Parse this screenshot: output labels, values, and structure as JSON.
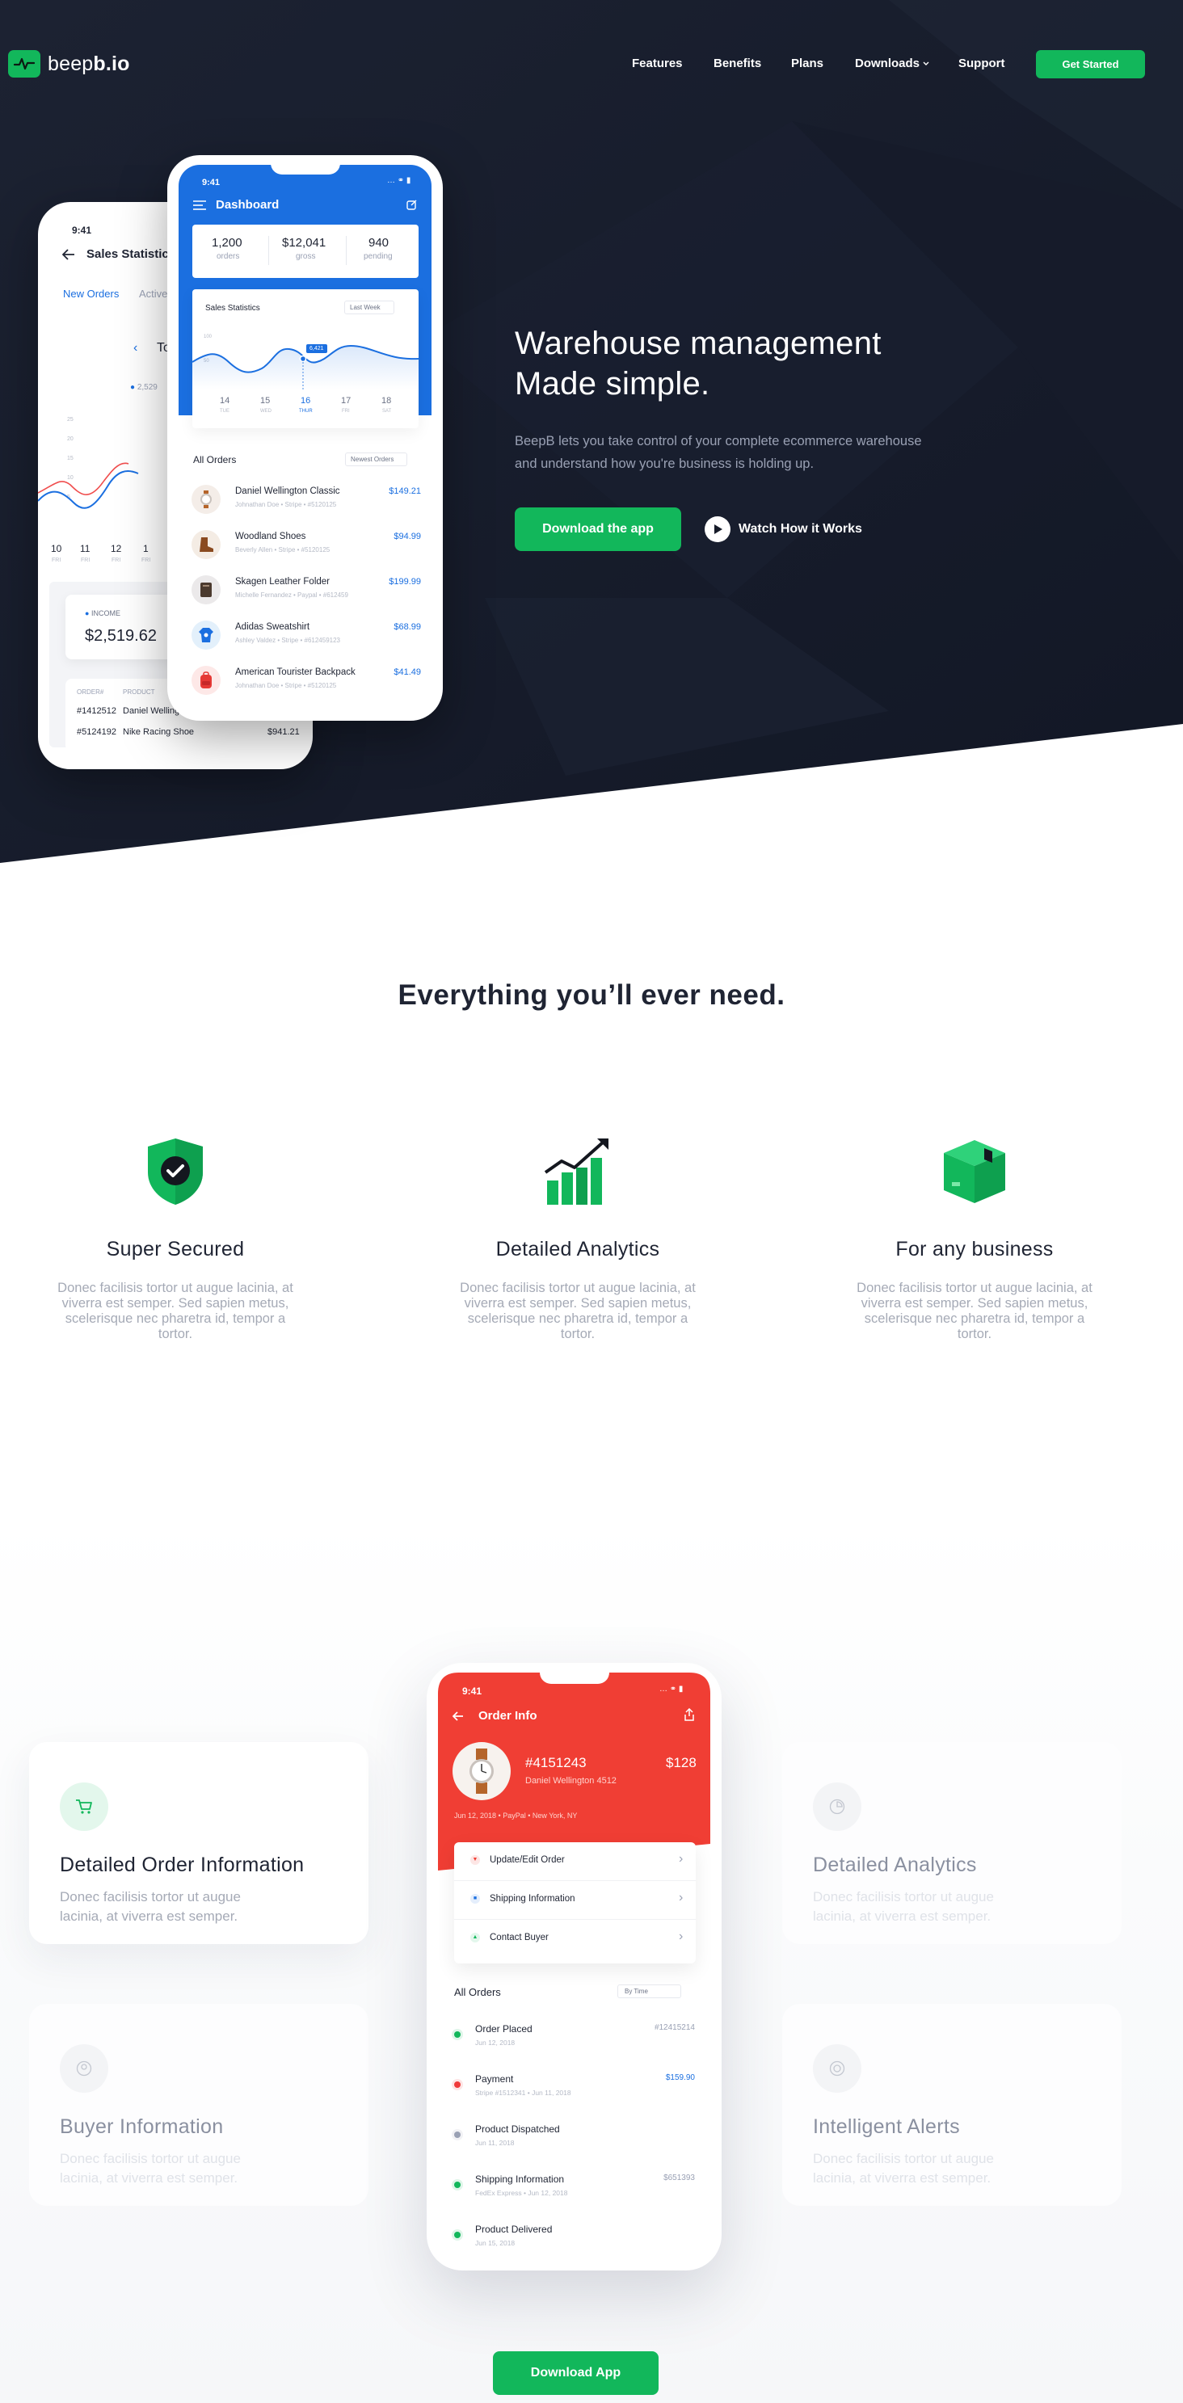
{
  "brand": {
    "name_light": "beep",
    "name_bold": "b.io",
    "accent": "#12b75b",
    "dark_bg": "#161b29"
  },
  "nav": {
    "links": [
      "Features",
      "Benefits",
      "Plans",
      "Downloads",
      "Support"
    ],
    "cta": "Get Started"
  },
  "hero": {
    "title_line1": "Warehouse management",
    "title_line2": "Made simple.",
    "description": "BeepB lets you take control of your complete ecommerce warehouse and understand how you're business is holding up.",
    "primary_button": "Download the app",
    "secondary_button": "Watch How it Works"
  },
  "phone_back": {
    "time": "9:41",
    "title": "Sales Statistics",
    "tabs": [
      "New Orders",
      "Active"
    ],
    "range_label": "To",
    "legend_value": "2,529",
    "y_ticks": [
      "25",
      "20",
      "15",
      "10",
      "5"
    ],
    "days": [
      {
        "num": "10",
        "abbr": "FRI"
      },
      {
        "num": "11",
        "abbr": "FRI"
      },
      {
        "num": "12",
        "abbr": "FRI"
      },
      {
        "num": "1",
        "abbr": "FRI"
      }
    ],
    "income_label": "INCOME",
    "income_value": "$2,519.62",
    "table_headers": [
      "ORDER#",
      "PRODUCT"
    ],
    "rows": [
      {
        "id": "#1412512",
        "product": "Daniel Wellington Wh...",
        "amount": "$149.50"
      },
      {
        "id": "#5124192",
        "product": "Nike Racing Shoe",
        "amount": "$941.21"
      }
    ]
  },
  "phone_front": {
    "time": "9:41",
    "title": "Dashboard",
    "stats": [
      {
        "value": "1,200",
        "label": "orders"
      },
      {
        "value": "$12,041",
        "label": "gross"
      },
      {
        "value": "940",
        "label": "pending"
      }
    ],
    "chart_title": "Sales Statistics",
    "chart_filter": "Last Week",
    "chart_tooltip": "6,421",
    "chart_y_ticks": [
      "100",
      "50"
    ],
    "days": [
      {
        "num": "14",
        "abbr": "TUE"
      },
      {
        "num": "15",
        "abbr": "WED"
      },
      {
        "num": "16",
        "abbr": "THUR"
      },
      {
        "num": "17",
        "abbr": "FRI"
      },
      {
        "num": "18",
        "abbr": "SAT"
      }
    ],
    "orders_title": "All Orders",
    "orders_filter": "Newest Orders",
    "orders": [
      {
        "name": "Daniel Wellington Classic",
        "meta": "Johnathan Doe  •  Stripe  •  #5120125",
        "price": "$149.21",
        "icon": "watch-icon"
      },
      {
        "name": "Woodland Shoes",
        "meta": "Beverly Allen  •  Stripe  •  #5120125",
        "price": "$94.99",
        "icon": "boot-icon"
      },
      {
        "name": "Skagen Leather Folder",
        "meta": "Michelle Fernandez  •  Paypal  •  #612459",
        "price": "$199.99",
        "icon": "folder-icon"
      },
      {
        "name": "Adidas Sweatshirt",
        "meta": "Ashley Valdez  •  Stripe  •  #612459123",
        "price": "$68.99",
        "icon": "sweatshirt-icon"
      },
      {
        "name": "American Tourister Backpack",
        "meta": "Johnathan Doe  •  Stripe  •  #5120125",
        "price": "$41.49",
        "icon": "backpack-icon"
      }
    ]
  },
  "features": {
    "heading": "Everything you’ll ever need.",
    "items": [
      {
        "title": "Super Secured",
        "text": "Donec facilisis tortor ut augue lacinia, at viverra est semper. Sed sapien metus, scelerisque nec pharetra id, tempor a tortor.",
        "icon": "shield-check-icon"
      },
      {
        "title": "Detailed Analytics",
        "text": "Donec facilisis tortor ut augue lacinia, at viverra est semper. Sed sapien metus, scelerisque nec pharetra id, tempor a tortor.",
        "icon": "growth-chart-icon"
      },
      {
        "title": "For any business",
        "text": "Donec facilisis tortor ut augue lacinia, at viverra est semper. Sed sapien metus, scelerisque nec pharetra id, tempor a tortor.",
        "icon": "box-icon"
      }
    ]
  },
  "details": {
    "cards": [
      {
        "title": "Detailed Order Information",
        "text": "Donec facilisis tortor ut augue lacinia, at viverra est semper.",
        "icon": "cart-icon"
      },
      {
        "title": "Buyer Information",
        "text": "Donec facilisis tortor ut augue lacinia, at viverra est semper.",
        "icon": "user-icon"
      },
      {
        "title": "Detailed Analytics",
        "text": "Donec facilisis tortor ut augue lacinia, at viverra est semper.",
        "icon": "pie-icon"
      },
      {
        "title": "Intelligent Alerts",
        "text": "Donec facilisis tortor ut augue lacinia, at viverra est semper.",
        "icon": "alert-icon"
      }
    ],
    "button": "Download App"
  },
  "phone_order": {
    "time": "9:41",
    "title": "Order Info",
    "order_id": "#4151243",
    "price": "$128",
    "product": "Daniel Wellington 4512",
    "meta": "Jun 12, 2018  •  PayPal  •  New York, NY",
    "actions": [
      "Update/Edit Order",
      "Shipping Information",
      "Contact Buyer"
    ],
    "list_title": "All Orders",
    "list_filter": "By Time",
    "events": [
      {
        "title": "Order Placed",
        "sub": "Jun 12, 2018",
        "value": "#12415214",
        "dot": "#12b75b"
      },
      {
        "title": "Payment",
        "sub": "Stripe #1512341  •  Jun 11, 2018",
        "value": "$159.90",
        "dot": "#f03a3a"
      },
      {
        "title": "Product Dispatched",
        "sub": "Jun 11, 2018",
        "value": "",
        "dot": "#9aa1b4"
      },
      {
        "title": "Shipping Information",
        "sub": "FedEx Express  •  Jun 12, 2018",
        "value": "$651393",
        "dot": "#12b75b"
      },
      {
        "title": "Product Delivered",
        "sub": "Jun 15, 2018",
        "value": "",
        "dot": "#12b75b"
      }
    ]
  }
}
